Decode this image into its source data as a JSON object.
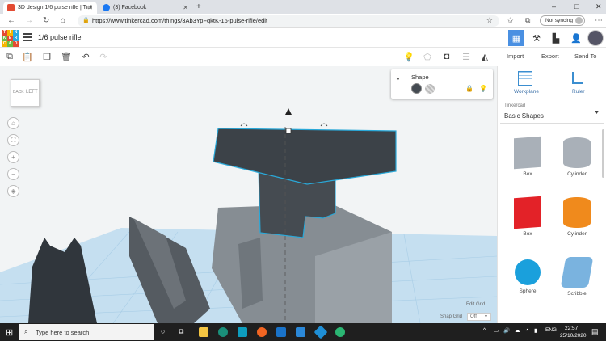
{
  "browser": {
    "tabs": [
      {
        "label": "3D design 1/6 pulse rifle | Tinker",
        "favicon_color": "#e34b33"
      },
      {
        "label": "(3) Facebook",
        "favicon_color": "#1877f2"
      }
    ],
    "new_tab": "+",
    "url": "https://www.tinkercad.com/things/3Ab3YpFqktK-16-pulse-rifle/edit",
    "sync_label": "Not syncing",
    "window_controls": [
      "–",
      "□",
      "✕"
    ]
  },
  "app": {
    "logo_letters": [
      "T",
      "I",
      "N",
      "K",
      "E",
      "R",
      "C",
      "A",
      "D"
    ],
    "logo_colors": [
      "#e34b33",
      "#f7b500",
      "#29a9e1",
      "#6dbb45",
      "#e34b33",
      "#29a9e1",
      "#f7b500",
      "#6dbb45",
      "#e34b33"
    ],
    "design_title": "1/6 pulse rifle",
    "actions": {
      "import": "Import",
      "export": "Export",
      "send_to": "Send To"
    }
  },
  "viewport": {
    "viewcube_label": "LEFT",
    "viewcube_small": "BACK",
    "shape_panel": {
      "title": "Shape"
    },
    "edit_grid": "Edit Grid",
    "snap_grid_label": "Snap Grid",
    "snap_grid_value": "Off"
  },
  "library": {
    "workplane_label": "Workplane",
    "ruler_label": "Ruler",
    "source": "Tinkercad",
    "category": "Basic Shapes",
    "shapes": [
      {
        "label": "Box",
        "color": "#a9b0b8"
      },
      {
        "label": "Cylinder",
        "color": "#a9b0b8"
      },
      {
        "label": "Box",
        "color": "#e32228"
      },
      {
        "label": "Cylinder",
        "color": "#f08a1c"
      },
      {
        "label": "Sphere",
        "color": "#1aa0dc"
      },
      {
        "label": "Scribble",
        "color": "#7ab3df"
      }
    ]
  },
  "taskbar": {
    "search_placeholder": "Type here to search",
    "language": "ENG",
    "time": "22:57",
    "date": "25/10/2020"
  }
}
